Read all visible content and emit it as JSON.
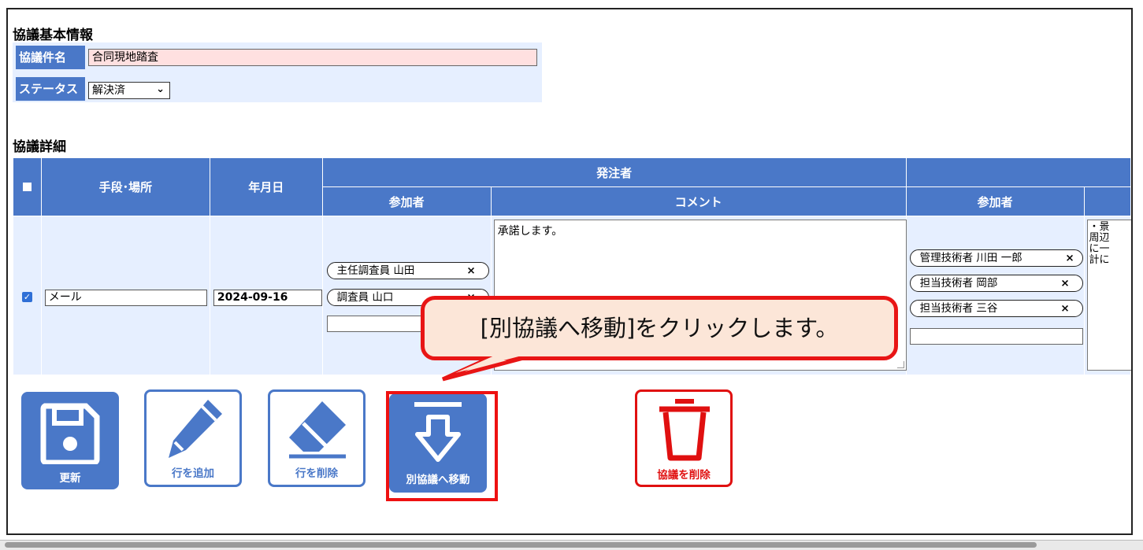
{
  "basic_info": {
    "section_title": "協議基本情報",
    "name_label": "協議件名",
    "name_value": "合同現地踏査",
    "status_label": "ステータス",
    "status_value": "解決済"
  },
  "detail": {
    "section_title": "協議詳細",
    "headers": {
      "method_place": "手段･場所",
      "date": "年月日",
      "orderer": "発注者",
      "participants": "参加者",
      "comment": "コメント",
      "participants2": "参加者"
    },
    "row": {
      "checked": true,
      "method": "メール",
      "date": "2024-09-16",
      "orderer_participants": [
        "主任調査員 山田",
        "調査員 山口"
      ],
      "orderer_comment": "承諾します。",
      "contractor_participants": [
        "管理技術者 川田 一郎",
        "担当技術者 岡部",
        "担当技術者 三谷"
      ],
      "contractor_comment_partial": "・景\n周辺\nに一\n計に"
    },
    "remove_mark": "×"
  },
  "toolbar": {
    "update_label": "更新",
    "add_row_label": "行を追加",
    "delete_row_label": "行を削除",
    "move_label": "別協議へ移動",
    "delete_meeting_label": "協議を削除"
  },
  "callout": {
    "text": "[別協議へ移動]をクリックします。"
  },
  "colors": {
    "header_blue": "#4a78c8",
    "panel_bg": "#e6efff",
    "highlight_red": "#e81515",
    "callout_bg": "#fce6d8",
    "name_input_bg": "#ffe0e0"
  }
}
